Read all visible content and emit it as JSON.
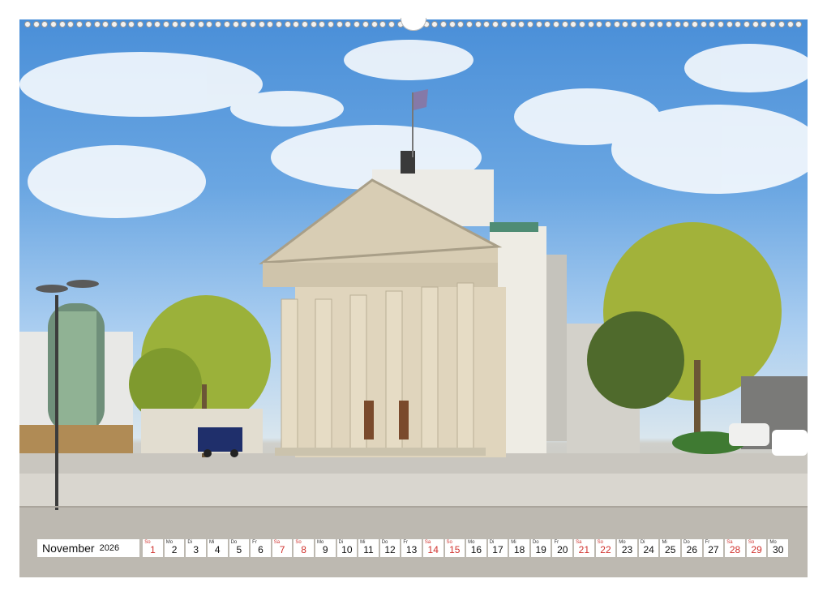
{
  "calendar": {
    "month": "November",
    "year": "2026",
    "days": [
      {
        "dn": "So",
        "d": "1",
        "weekend": true
      },
      {
        "dn": "Mo",
        "d": "2",
        "weekend": false
      },
      {
        "dn": "Di",
        "d": "3",
        "weekend": false
      },
      {
        "dn": "Mi",
        "d": "4",
        "weekend": false
      },
      {
        "dn": "Do",
        "d": "5",
        "weekend": false
      },
      {
        "dn": "Fr",
        "d": "6",
        "weekend": false
      },
      {
        "dn": "Sa",
        "d": "7",
        "weekend": true
      },
      {
        "dn": "So",
        "d": "8",
        "weekend": true
      },
      {
        "dn": "Mo",
        "d": "9",
        "weekend": false
      },
      {
        "dn": "Di",
        "d": "10",
        "weekend": false
      },
      {
        "dn": "Mi",
        "d": "11",
        "weekend": false
      },
      {
        "dn": "Do",
        "d": "12",
        "weekend": false
      },
      {
        "dn": "Fr",
        "d": "13",
        "weekend": false
      },
      {
        "dn": "Sa",
        "d": "14",
        "weekend": true
      },
      {
        "dn": "So",
        "d": "15",
        "weekend": true
      },
      {
        "dn": "Mo",
        "d": "16",
        "weekend": false
      },
      {
        "dn": "Di",
        "d": "17",
        "weekend": false
      },
      {
        "dn": "Mi",
        "d": "18",
        "weekend": false
      },
      {
        "dn": "Do",
        "d": "19",
        "weekend": false
      },
      {
        "dn": "Fr",
        "d": "20",
        "weekend": false
      },
      {
        "dn": "Sa",
        "d": "21",
        "weekend": true
      },
      {
        "dn": "So",
        "d": "22",
        "weekend": true
      },
      {
        "dn": "Mo",
        "d": "23",
        "weekend": false
      },
      {
        "dn": "Di",
        "d": "24",
        "weekend": false
      },
      {
        "dn": "Mi",
        "d": "25",
        "weekend": false
      },
      {
        "dn": "Do",
        "d": "26",
        "weekend": false
      },
      {
        "dn": "Fr",
        "d": "27",
        "weekend": false
      },
      {
        "dn": "Sa",
        "d": "28",
        "weekend": true
      },
      {
        "dn": "So",
        "d": "29",
        "weekend": true
      },
      {
        "dn": "Mo",
        "d": "30",
        "weekend": false
      }
    ]
  },
  "colors": {
    "weekend": "#d0312d",
    "sky": "#4a8fd8",
    "stone": "#d8cdb4"
  }
}
